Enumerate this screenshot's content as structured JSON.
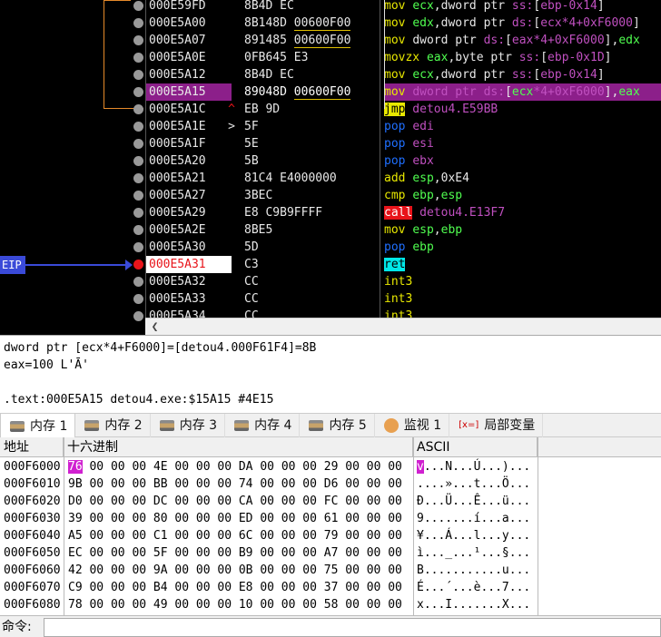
{
  "disasm": {
    "rows": [
      {
        "addr": "000E59FD",
        "mark": "",
        "bytes": "8B4D EC",
        "asm": [
          [
            "mov ",
            "mn-mov"
          ],
          [
            "ecx",
            "reg"
          ],
          [
            ",dword ptr ",
            "white"
          ],
          [
            "ss:",
            "seg"
          ],
          [
            "[",
            "white"
          ],
          [
            "ebp-0x14",
            "op-tgt"
          ],
          [
            "]",
            "white"
          ]
        ]
      },
      {
        "addr": "000E5A00",
        "mark": "",
        "bytes": "8B148D ",
        "bytes_u": "00600F00",
        "asm": [
          [
            "mov ",
            "mn-mov"
          ],
          [
            "edx",
            "reg"
          ],
          [
            ",dword ptr ",
            "white"
          ],
          [
            "ds:",
            "seg"
          ],
          [
            "[",
            "white"
          ],
          [
            "ecx*4+0xF6000",
            "op-tgt"
          ],
          [
            "]",
            "white"
          ]
        ]
      },
      {
        "addr": "000E5A07",
        "mark": "",
        "bytes": "891485 ",
        "bytes_u": "00600F00",
        "asm": [
          [
            "mov ",
            "mn-mov"
          ],
          [
            "dword ptr ",
            "white"
          ],
          [
            "ds:",
            "seg"
          ],
          [
            "[",
            "white"
          ],
          [
            "eax*4+0xF6000",
            "op-tgt"
          ],
          [
            "],",
            "white"
          ],
          [
            "edx",
            "reg"
          ]
        ]
      },
      {
        "addr": "000E5A0E",
        "mark": "",
        "bytes": "0FB645 E3",
        "asm": [
          [
            "movzx ",
            "mn-mov"
          ],
          [
            "eax",
            "reg"
          ],
          [
            ",byte ptr ",
            "white"
          ],
          [
            "ss:",
            "seg"
          ],
          [
            "[",
            "white"
          ],
          [
            "ebp-0x1D",
            "op-tgt"
          ],
          [
            "]",
            "white"
          ]
        ]
      },
      {
        "addr": "000E5A12",
        "mark": "",
        "bytes": "8B4D EC",
        "asm": [
          [
            "mov ",
            "mn-mov"
          ],
          [
            "ecx",
            "reg"
          ],
          [
            ",dword ptr ",
            "white"
          ],
          [
            "ss:",
            "seg"
          ],
          [
            "[",
            "white"
          ],
          [
            "ebp-0x14",
            "op-tgt"
          ],
          [
            "]",
            "white"
          ]
        ]
      },
      {
        "addr": "000E5A15",
        "mark": "",
        "bytes": "89048D ",
        "bytes_u": "00600F00",
        "sel": true,
        "asm": [
          [
            "mov ",
            "mn-mov"
          ],
          [
            "dword ptr ",
            "op-tgt"
          ],
          [
            "ds:",
            "seg"
          ],
          [
            "[",
            "white"
          ],
          [
            "ecx",
            "reg"
          ],
          [
            "*4+0xF6000",
            "op-tgt"
          ],
          [
            "],",
            "white"
          ],
          [
            "eax",
            "reg"
          ]
        ]
      },
      {
        "addr": "000E5A1C",
        "mark": "^",
        "markcls": "jmpmark",
        "bytes": "EB 9D",
        "asm": [
          [
            "jmp",
            "mn-jmp"
          ],
          [
            " detou4.E59BB",
            "op-tgt"
          ]
        ]
      },
      {
        "addr": "000E5A1E",
        "mark": ">",
        "bytes": "5F",
        "asm": [
          [
            "pop ",
            "mn-pop"
          ],
          [
            "edi",
            "op-tgt"
          ]
        ]
      },
      {
        "addr": "000E5A1F",
        "mark": "",
        "bytes": "5E",
        "asm": [
          [
            "pop ",
            "mn-pop"
          ],
          [
            "esi",
            "op-tgt"
          ]
        ]
      },
      {
        "addr": "000E5A20",
        "mark": "",
        "bytes": "5B",
        "asm": [
          [
            "pop ",
            "mn-pop"
          ],
          [
            "ebx",
            "op-tgt"
          ]
        ]
      },
      {
        "addr": "000E5A21",
        "mark": "",
        "bytes": "81C4 E4000000",
        "asm": [
          [
            "add ",
            "mn-add"
          ],
          [
            "esp",
            "reg"
          ],
          [
            ",0xE4",
            "white"
          ]
        ]
      },
      {
        "addr": "000E5A27",
        "mark": "",
        "bytes": "3BEC",
        "asm": [
          [
            "cmp ",
            "mn-cmp"
          ],
          [
            "ebp",
            "reg"
          ],
          [
            ",",
            "white"
          ],
          [
            "esp",
            "reg"
          ]
        ]
      },
      {
        "addr": "000E5A29",
        "mark": "",
        "bytes": "E8 C9B9FFFF",
        "asm": [
          [
            "call",
            "mn-call"
          ],
          [
            " detou4.E13F7",
            "op-tgt"
          ]
        ]
      },
      {
        "addr": "000E5A2E",
        "mark": "",
        "bytes": "8BE5",
        "asm": [
          [
            "mov ",
            "mn-mov"
          ],
          [
            "esp",
            "reg"
          ],
          [
            ",",
            "white"
          ],
          [
            "ebp",
            "reg"
          ]
        ]
      },
      {
        "addr": "000E5A30",
        "mark": "",
        "bytes": "5D",
        "asm": [
          [
            "pop ",
            "mn-pop"
          ],
          [
            "ebp",
            "reg"
          ]
        ]
      },
      {
        "addr": "000E5A31",
        "mark": "",
        "bytes": "C3",
        "eip": true,
        "asm": [
          [
            "ret",
            "mn-ret"
          ]
        ]
      },
      {
        "addr": "000E5A32",
        "mark": "",
        "bytes": "CC",
        "asm": [
          [
            "int3",
            "mn-int"
          ]
        ]
      },
      {
        "addr": "000E5A33",
        "mark": "",
        "bytes": "CC",
        "asm": [
          [
            "int3",
            "mn-int"
          ]
        ]
      },
      {
        "addr": "000E5A34",
        "mark": "",
        "bytes": "CC",
        "asm": [
          [
            "int3",
            "mn-int"
          ]
        ]
      }
    ],
    "eip_label": "EIP"
  },
  "info": {
    "line1": "dword ptr [ecx*4+F6000]=[detou4.000F61F4]=8B",
    "line2": "eax=100 L'Ā'",
    "line3": "",
    "line4": ".text:000E5A15 detou4.exe:$15A15 #4E15"
  },
  "tabs": [
    {
      "label": "内存 1",
      "icon": "memory-icon",
      "active": true
    },
    {
      "label": "内存 2",
      "icon": "memory-icon"
    },
    {
      "label": "内存 3",
      "icon": "memory-icon"
    },
    {
      "label": "内存 4",
      "icon": "memory-icon"
    },
    {
      "label": "内存 5",
      "icon": "memory-icon"
    },
    {
      "label": "监视 1",
      "icon": "watch-icon"
    },
    {
      "label": "局部变量",
      "icon": "locals-icon",
      "iconText": "[x=]"
    }
  ],
  "dump": {
    "headers": {
      "addr": "地址",
      "hex": "十六进制",
      "ascii": "ASCII"
    },
    "rows": [
      {
        "addr": "000F6000",
        "hex": [
          "76 00 00 00",
          "4E 00 00 00",
          "DA 00 00 00",
          "29 00 00 00"
        ],
        "ascii": "v...N...Ú...)..."
      },
      {
        "addr": "000F6010",
        "hex": [
          "9B 00 00 00",
          "BB 00 00 00",
          "74 00 00 00",
          "D6 00 00 00"
        ],
        "ascii": "....»...t...Ö..."
      },
      {
        "addr": "000F6020",
        "hex": [
          "D0 00 00 00",
          "DC 00 00 00",
          "CA 00 00 00",
          "FC 00 00 00"
        ],
        "ascii": "Ð...Ü...Ê...ü..."
      },
      {
        "addr": "000F6030",
        "hex": [
          "39 00 00 00",
          "80 00 00 00",
          "ED 00 00 00",
          "61 00 00 00"
        ],
        "ascii": "9.......í...a..."
      },
      {
        "addr": "000F6040",
        "hex": [
          "A5 00 00 00",
          "C1 00 00 00",
          "6C 00 00 00",
          "79 00 00 00"
        ],
        "ascii": "¥...Á...l...y..."
      },
      {
        "addr": "000F6050",
        "hex": [
          "EC 00 00 00",
          "5F 00 00 00",
          "B9 00 00 00",
          "A7 00 00 00"
        ],
        "ascii": "ì..._...¹...§..."
      },
      {
        "addr": "000F6060",
        "hex": [
          "42 00 00 00",
          "9A 00 00 00",
          "0B 00 00 00",
          "75 00 00 00"
        ],
        "ascii": "B...........u..."
      },
      {
        "addr": "000F6070",
        "hex": [
          "C9 00 00 00",
          "B4 00 00 00",
          "E8 00 00 00",
          "37 00 00 00"
        ],
        "ascii": "É...´...è...7..."
      },
      {
        "addr": "000F6080",
        "hex": [
          "78 00 00 00",
          "49 00 00 00",
          "10 00 00 00",
          "58 00 00 00"
        ],
        "ascii": "x...I.......X..."
      }
    ]
  },
  "cmd": {
    "label": "命令:",
    "value": ""
  }
}
